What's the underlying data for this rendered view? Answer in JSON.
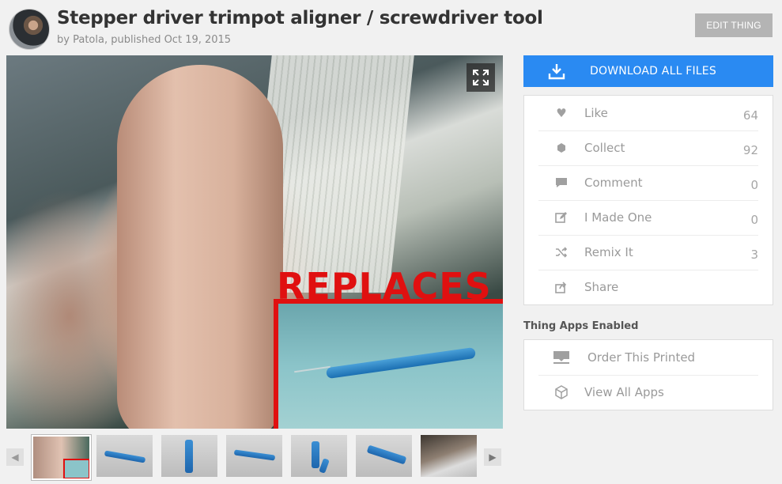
{
  "header": {
    "title": "Stepper driver trimpot aligner / screwdriver tool",
    "byline_prefix": "by",
    "author": "Patola",
    "published": ", published Oct 19, 2015",
    "edit_label": "EDIT THING"
  },
  "main_image": {
    "overlay_text": "REPLACES",
    "expand_icon": "fullscreen-icon"
  },
  "thumbnails": {
    "count_visible": 7,
    "prev_icon": "chevron-left-icon",
    "next_icon": "chevron-right-icon"
  },
  "sidebar": {
    "download_label": "DOWNLOAD ALL FILES",
    "actions": [
      {
        "label": "Like",
        "count": "64",
        "icon": "heart-icon"
      },
      {
        "label": "Collect",
        "count": "92",
        "icon": "collect-icon"
      },
      {
        "label": "Comment",
        "count": "0",
        "icon": "comment-icon"
      },
      {
        "label": "I Made One",
        "count": "0",
        "icon": "edit-icon"
      },
      {
        "label": "Remix It",
        "count": "3",
        "icon": "shuffle-icon"
      },
      {
        "label": "Share",
        "count": "",
        "icon": "share-icon"
      }
    ],
    "apps_heading": "Thing Apps Enabled",
    "apps": [
      {
        "label": "Order This Printed",
        "icon": "printer-icon"
      },
      {
        "label": "View All Apps",
        "icon": "cube-icon"
      }
    ]
  },
  "colors": {
    "accent": "#2a8af2",
    "overlay_red": "#e01010"
  }
}
